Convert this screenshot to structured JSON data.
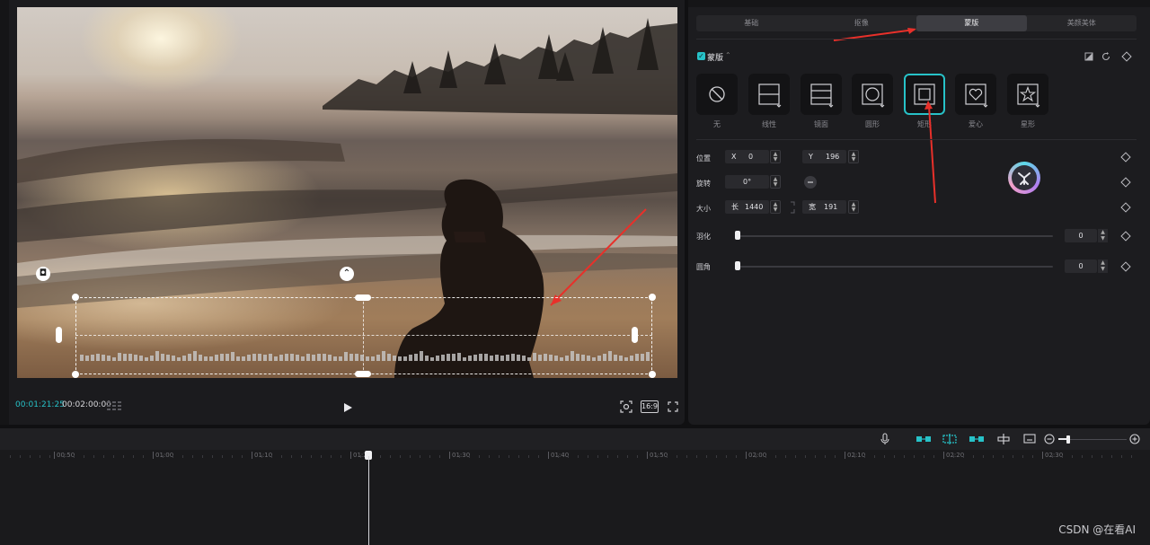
{
  "player": {
    "current_time": "00:01:21:25",
    "total_time": "00:02:00:00",
    "ratio_label": "16:9"
  },
  "properties": {
    "tabs": [
      {
        "label": "基础",
        "active": false
      },
      {
        "label": "抠像",
        "active": false
      },
      {
        "label": "蒙版",
        "active": true
      },
      {
        "label": "美颜美体",
        "active": false
      }
    ],
    "mask_section_title": "蒙版",
    "mask_enabled": true,
    "shapes": [
      {
        "label": "无",
        "icon": "none-icon",
        "selected": false
      },
      {
        "label": "线性",
        "icon": "linear-mask-icon",
        "selected": false
      },
      {
        "label": "镜面",
        "icon": "mirror-mask-icon",
        "selected": false
      },
      {
        "label": "圆形",
        "icon": "circle-mask-icon",
        "selected": false
      },
      {
        "label": "矩形",
        "icon": "rectangle-mask-icon",
        "selected": true
      },
      {
        "label": "爱心",
        "icon": "heart-mask-icon",
        "selected": false
      },
      {
        "label": "星形",
        "icon": "star-mask-icon",
        "selected": false
      }
    ],
    "position": {
      "label": "位置",
      "x_prefix": "X",
      "x": "0",
      "y_prefix": "Y",
      "y": "196"
    },
    "rotation": {
      "label": "旋转",
      "value": "0°"
    },
    "size": {
      "label": "大小",
      "w_prefix": "长",
      "w": "1440",
      "h_prefix": "宽",
      "h": "191"
    },
    "feather": {
      "label": "羽化",
      "value": "0",
      "fraction": 0
    },
    "corner": {
      "label": "圆角",
      "value": "0",
      "fraction": 0
    }
  },
  "timeline": {
    "ticks": [
      "00:50",
      "01:00",
      "01:10",
      "01:20",
      "01:30",
      "01:40",
      "01:50",
      "02:00",
      "02:10",
      "02:20",
      "02:30"
    ]
  },
  "watermark": "CSDN @在看AI",
  "colors": {
    "accent": "#27c2c8",
    "annotation_arrow": "#e8302a"
  }
}
